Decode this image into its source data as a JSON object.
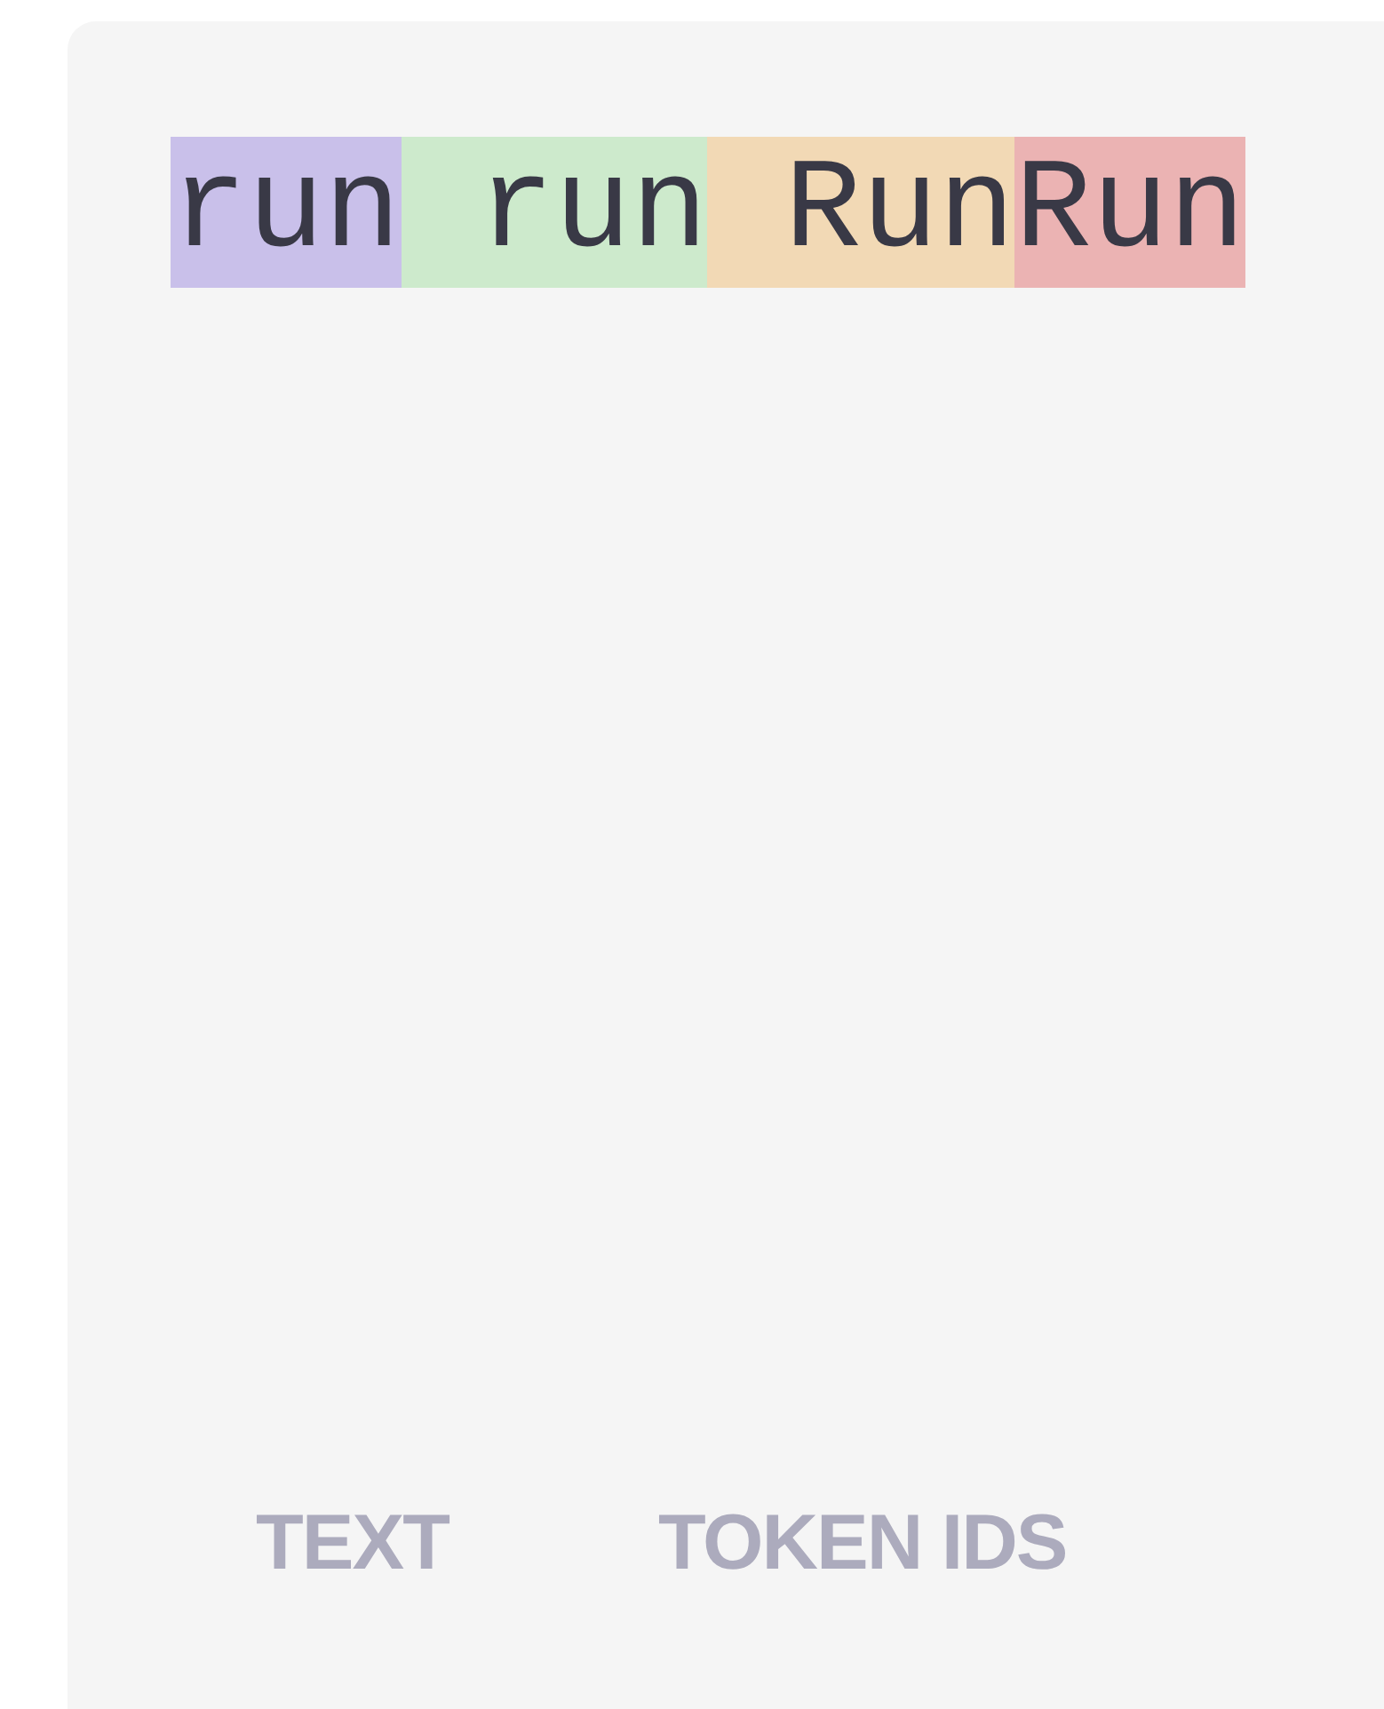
{
  "tokens": [
    {
      "text": "run",
      "color": "#c9c0ea"
    },
    {
      "text": " run",
      "color": "#cdeacc"
    },
    {
      "text": " Run",
      "color": "#f2d9b5"
    },
    {
      "text": "Run",
      "color": "#ebb3b3"
    }
  ],
  "buttons": [
    "TEXT",
    "TOKEN IDS"
  ]
}
